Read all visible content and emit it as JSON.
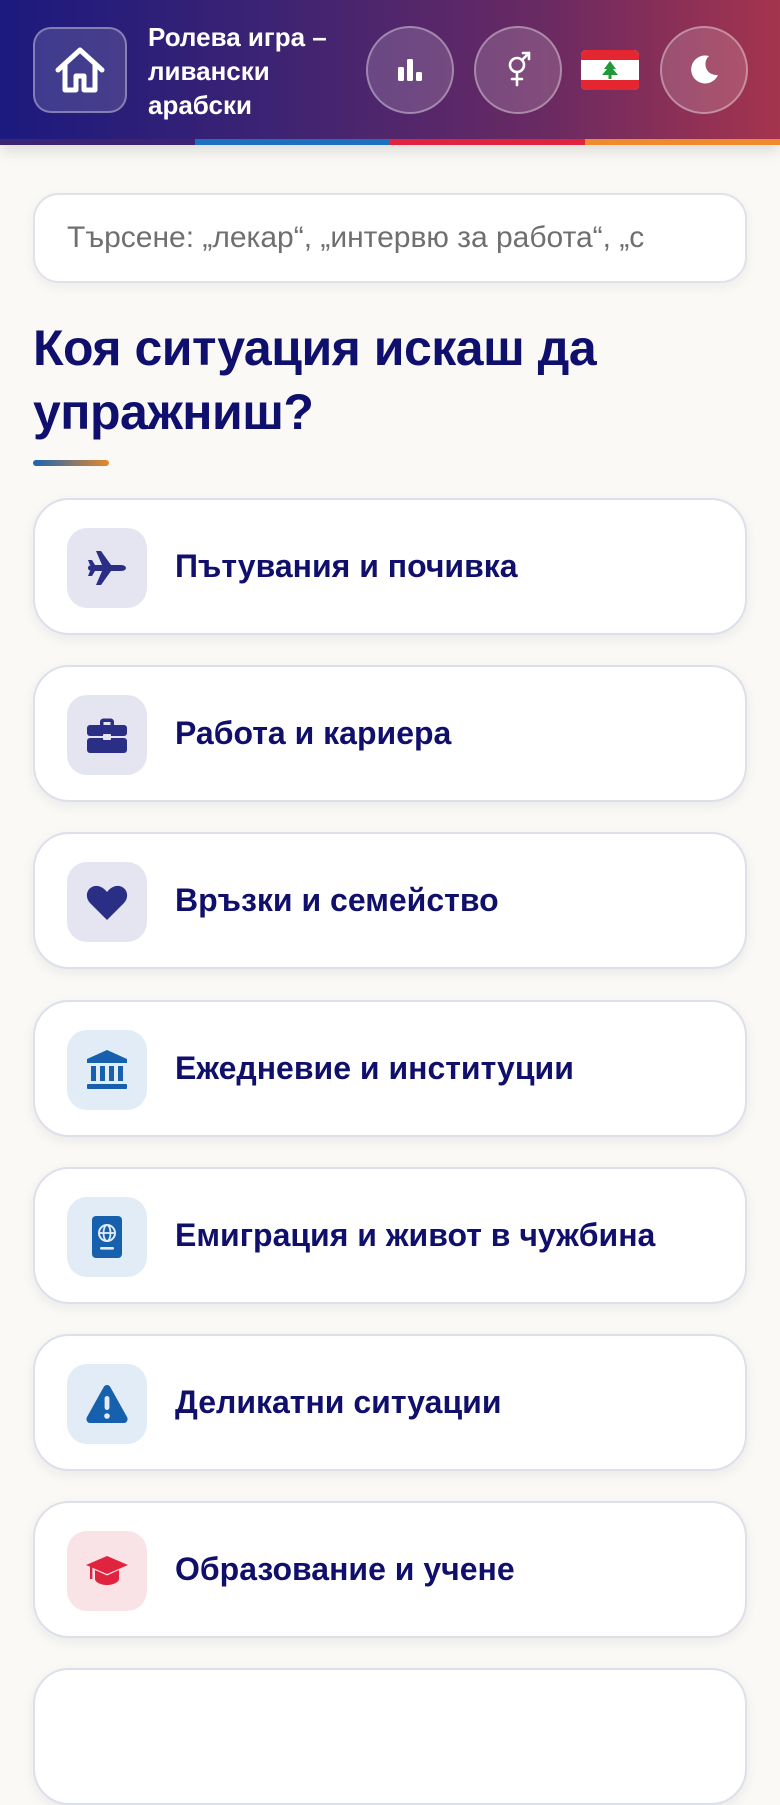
{
  "header": {
    "title": "Ролева игра – ливански арабски",
    "stripe_colors": [
      "#3d2373",
      "#1d6fc0",
      "#e0243f",
      "#ef8a2d"
    ]
  },
  "search": {
    "placeholder": "Търсене: „лекар“, „интервю за работа“, „с"
  },
  "main": {
    "heading": "Коя ситуация искаш да упражниш?",
    "categories": [
      {
        "label": "Пътувания и почивка",
        "icon": "airplane-icon",
        "icon_color": "#2a2f85",
        "tile_color": "#e5e5f2"
      },
      {
        "label": "Работа и кариера",
        "icon": "briefcase-icon",
        "icon_color": "#2a2f85",
        "tile_color": "#e5e5f2"
      },
      {
        "label": "Връзки и семейство",
        "icon": "heart-icon",
        "icon_color": "#2a2f85",
        "tile_color": "#e5e5f2"
      },
      {
        "label": "Ежедневие и институции",
        "icon": "building-columns-icon",
        "icon_color": "#1660ad",
        "tile_color": "#e1ecf7"
      },
      {
        "label": "Емиграция и живот в чужбина",
        "icon": "passport-icon",
        "icon_color": "#1660ad",
        "tile_color": "#e1ecf7"
      },
      {
        "label": "Деликатни ситуации",
        "icon": "warning-icon",
        "icon_color": "#1660ad",
        "tile_color": "#e1ecf7"
      },
      {
        "label": "Образование и учене",
        "icon": "graduation-cap-icon",
        "icon_color": "#e0243f",
        "tile_color": "#fae3e6"
      }
    ]
  }
}
